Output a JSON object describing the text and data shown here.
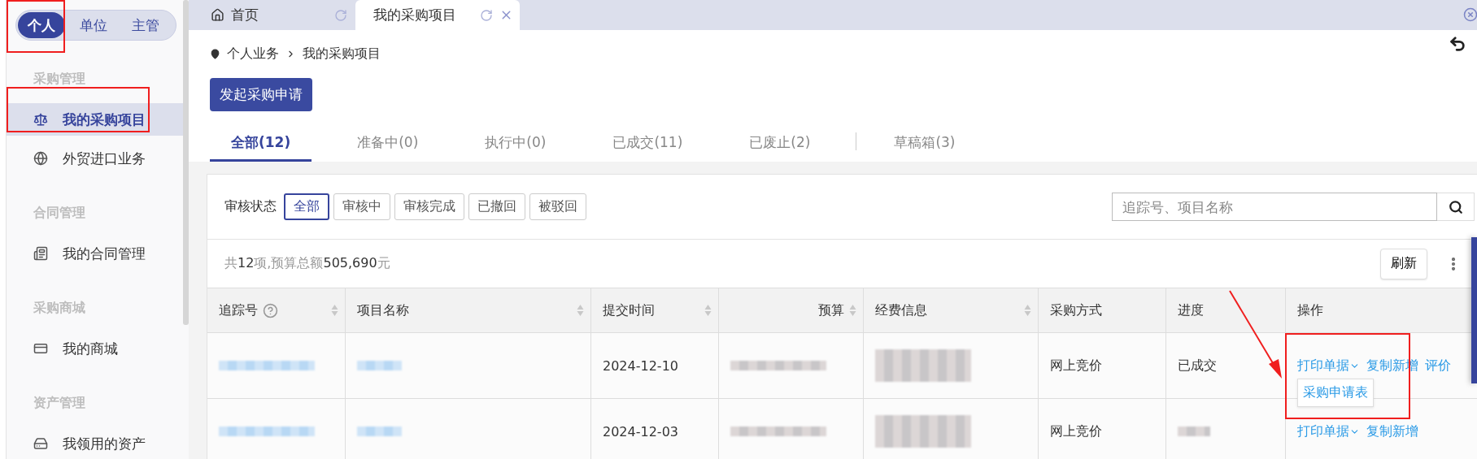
{
  "role_switch": [
    {
      "label": "个人",
      "selected": true
    },
    {
      "label": "单位",
      "selected": false
    },
    {
      "label": "主管",
      "selected": false
    }
  ],
  "sidebar": {
    "groups": [
      {
        "heading": "采购管理",
        "items": [
          {
            "label": "我的采购项目",
            "kind": "scale",
            "selected": true
          },
          {
            "label": "外贸进口业务",
            "kind": "globe",
            "selected": false
          }
        ]
      },
      {
        "heading": "合同管理",
        "items": [
          {
            "label": "我的合同管理",
            "kind": "document",
            "selected": false
          }
        ]
      },
      {
        "heading": "采购商城",
        "items": [
          {
            "label": "我的商城",
            "kind": "card",
            "selected": false
          }
        ]
      },
      {
        "heading": "资产管理",
        "items": [
          {
            "label": "我领用的资产",
            "kind": "drive",
            "selected": false
          }
        ]
      }
    ]
  },
  "page_tabs": [
    {
      "label": "首页",
      "kind": "home",
      "selected": false
    },
    {
      "label": "我的采购项目",
      "kind": "page",
      "selected": true
    }
  ],
  "breadcrumb": [
    "个人业务",
    "我的采购项目"
  ],
  "primary_button": "发起采购申请",
  "status_tabs": [
    {
      "kind": "tab",
      "label": "全部(12)",
      "selected": true
    },
    {
      "kind": "tab",
      "label": "准备中(0)",
      "selected": false
    },
    {
      "kind": "tab",
      "label": "执行中(0)",
      "selected": false
    },
    {
      "kind": "tab",
      "label": "已成交(11)",
      "selected": false
    },
    {
      "kind": "tab",
      "label": "已废止(2)",
      "selected": false
    },
    {
      "kind": "divider"
    },
    {
      "kind": "tab",
      "label": "草稿箱(3)",
      "selected": false
    }
  ],
  "filter": {
    "label": "审核状态",
    "options": [
      {
        "label": "全部",
        "selected": true
      },
      {
        "label": "审核中",
        "selected": false
      },
      {
        "label": "审核完成",
        "selected": false
      },
      {
        "label": "已撤回",
        "selected": false
      },
      {
        "label": "被驳回",
        "selected": false
      }
    ]
  },
  "search": {
    "placeholder": "追踪号、项目名称"
  },
  "summary": "共**12**项,预算总额**505,690**元",
  "refresh_button": "刷新",
  "table": {
    "columns": [
      {
        "label": "追踪号",
        "sortable": true,
        "help": true
      },
      {
        "label": "项目名称",
        "sortable": true,
        "help": false
      },
      {
        "label": "提交时间",
        "sortable": true,
        "help": false
      },
      {
        "label": "预算",
        "sortable": true,
        "help": false
      },
      {
        "label": "经费信息",
        "sortable": true,
        "help": false
      },
      {
        "label": "采购方式",
        "sortable": false,
        "help": false
      },
      {
        "label": "进度",
        "sortable": false,
        "help": false
      },
      {
        "label": "操作",
        "sortable": false,
        "help": false
      }
    ],
    "rows": [
      {
        "cells": [
          {
            "kind": "redacted"
          },
          {
            "kind": "redacted"
          },
          {
            "kind": "text",
            "text": "2024-12-10"
          },
          {
            "kind": "redacted"
          },
          {
            "kind": "redacted"
          },
          {
            "kind": "text",
            "text": "网上竞价"
          },
          {
            "kind": "text",
            "text": "已成交"
          },
          {
            "kind": "actions",
            "actions": [
              {
                "label": "打印单据",
                "dropdown": true,
                "menu": [
                  "采购申请表"
                ]
              },
              {
                "label": "复制新增",
                "dropdown": false
              },
              {
                "label": "评价",
                "dropdown": false
              }
            ]
          }
        ]
      },
      {
        "cells": [
          {
            "kind": "redacted"
          },
          {
            "kind": "redacted"
          },
          {
            "kind": "text",
            "text": "2024-12-03"
          },
          {
            "kind": "redacted"
          },
          {
            "kind": "redacted"
          },
          {
            "kind": "text",
            "text": "网上竞价"
          },
          {
            "kind": "redacted"
          },
          {
            "kind": "actions",
            "actions": [
              {
                "label": "打印单据",
                "dropdown": true
              },
              {
                "label": "复制新增",
                "dropdown": false
              }
            ]
          }
        ]
      }
    ]
  }
}
